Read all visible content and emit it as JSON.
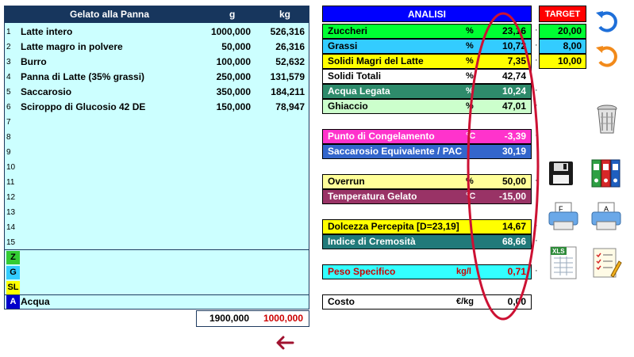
{
  "recipe": {
    "title": "Gelato alla Panna",
    "col_g": "g",
    "col_kg": "kg",
    "rows": [
      {
        "n": "1",
        "name": "Latte intero",
        "g": "1000,000",
        "kg": "526,316"
      },
      {
        "n": "2",
        "name": "Latte magro in polvere",
        "g": "50,000",
        "kg": "26,316"
      },
      {
        "n": "3",
        "name": "Burro",
        "g": "100,000",
        "kg": "52,632"
      },
      {
        "n": "4",
        "name": "Panna di Latte (35% grassi)",
        "g": "250,000",
        "kg": "131,579"
      },
      {
        "n": "5",
        "name": "Saccarosio",
        "g": "350,000",
        "kg": "184,211"
      },
      {
        "n": "6",
        "name": "Sciroppo di Glucosio 42 DE",
        "g": "150,000",
        "kg": "78,947"
      },
      {
        "n": "7",
        "name": "",
        "g": "",
        "kg": ""
      },
      {
        "n": "8",
        "name": "",
        "g": "",
        "kg": ""
      },
      {
        "n": "9",
        "name": "",
        "g": "",
        "kg": ""
      },
      {
        "n": "10",
        "name": "",
        "g": "",
        "kg": ""
      },
      {
        "n": "11",
        "name": "",
        "g": "",
        "kg": ""
      },
      {
        "n": "12",
        "name": "",
        "g": "",
        "kg": ""
      },
      {
        "n": "13",
        "name": "",
        "g": "",
        "kg": ""
      },
      {
        "n": "14",
        "name": "",
        "g": "",
        "kg": ""
      },
      {
        "n": "15",
        "name": "",
        "g": "",
        "kg": ""
      }
    ],
    "badges": [
      {
        "letter": "Z",
        "color": "#33cc33"
      },
      {
        "letter": "G",
        "color": "#33ccff"
      },
      {
        "letter": "SL",
        "color": "#ffff00"
      },
      {
        "letter": "A",
        "color": "#0000cc"
      }
    ],
    "water_label": "Acqua",
    "total_g": "1900,000",
    "total_kg": "1000,000",
    "total_kg_color": "#cc0000"
  },
  "analysis": {
    "header": "ANALISI",
    "rows": [
      {
        "label": "Zuccheri",
        "unit": "%",
        "value": "23,16",
        "bg": "#00ff33",
        "fg": "#000000"
      },
      {
        "label": "Grassi",
        "unit": "%",
        "value": "10,72",
        "bg": "#33ccff",
        "fg": "#000000"
      },
      {
        "label": "Solidi Magri del Latte",
        "unit": "%",
        "value": "7,35",
        "bg": "#ffff00",
        "fg": "#000000"
      },
      {
        "label": "Solidi Totali",
        "unit": "%",
        "value": "42,74",
        "bg": "#ffffff",
        "fg": "#000000"
      },
      {
        "label": "Acqua Legata",
        "unit": "%",
        "value": "10,24",
        "bg": "#2e8b6b",
        "fg": "#ffffff"
      },
      {
        "label": "Ghiaccio",
        "unit": "%",
        "value": "47,01",
        "bg": "#ccffcc",
        "fg": "#000000"
      },
      {
        "label": "Punto di Congelamento",
        "unit": "°C",
        "value": "-3,39",
        "bg": "#ff33cc",
        "fg": "#ffffff"
      },
      {
        "label": "Saccarosio Equivalente / PAC",
        "unit": "",
        "value": "30,19",
        "bg": "#3366cc",
        "fg": "#ffffff"
      },
      {
        "label": "Overrun",
        "unit": "%",
        "value": "50,00",
        "bg": "#ffff99",
        "fg": "#000000"
      },
      {
        "label": "Temperatura Gelato",
        "unit": "°C",
        "value": "-15,00",
        "bg": "#993366",
        "fg": "#ffffff"
      },
      {
        "label": "Dolcezza Percepita [D=23,19]",
        "unit": "",
        "value": "14,67",
        "bg": "#ffff00",
        "fg": "#000000"
      },
      {
        "label": "Indice di Cremosità",
        "unit": "",
        "value": "68,66",
        "bg": "#217a7a",
        "fg": "#ffffff"
      },
      {
        "label": "Peso Specifico",
        "unit": "kg/l",
        "value": "0,71",
        "bg": "#33ffff",
        "fg": "#cc0000"
      },
      {
        "label": "Costo",
        "unit": "€/kg",
        "value": "0,00",
        "bg": "#ffffff",
        "fg": "#000000"
      }
    ],
    "dot": "·"
  },
  "target": {
    "header": "TARGET",
    "rows": [
      {
        "value": "20,00",
        "bg": "#00ff33"
      },
      {
        "value": "8,00",
        "bg": "#33ccff"
      },
      {
        "value": "10,00",
        "bg": "#ffff00"
      }
    ]
  },
  "arrow": "🡐",
  "colors": {
    "navy": "#17365d",
    "analysis_header": "#0000ff",
    "target_header": "#ff0000",
    "annotation_oval": "#cc1133"
  },
  "icons": [
    "undo-icon",
    "redo-icon",
    "trash-icon",
    "save-icon",
    "binders-icon",
    "print-f-icon",
    "print-a-icon",
    "excel-icon",
    "notepad-icon"
  ]
}
